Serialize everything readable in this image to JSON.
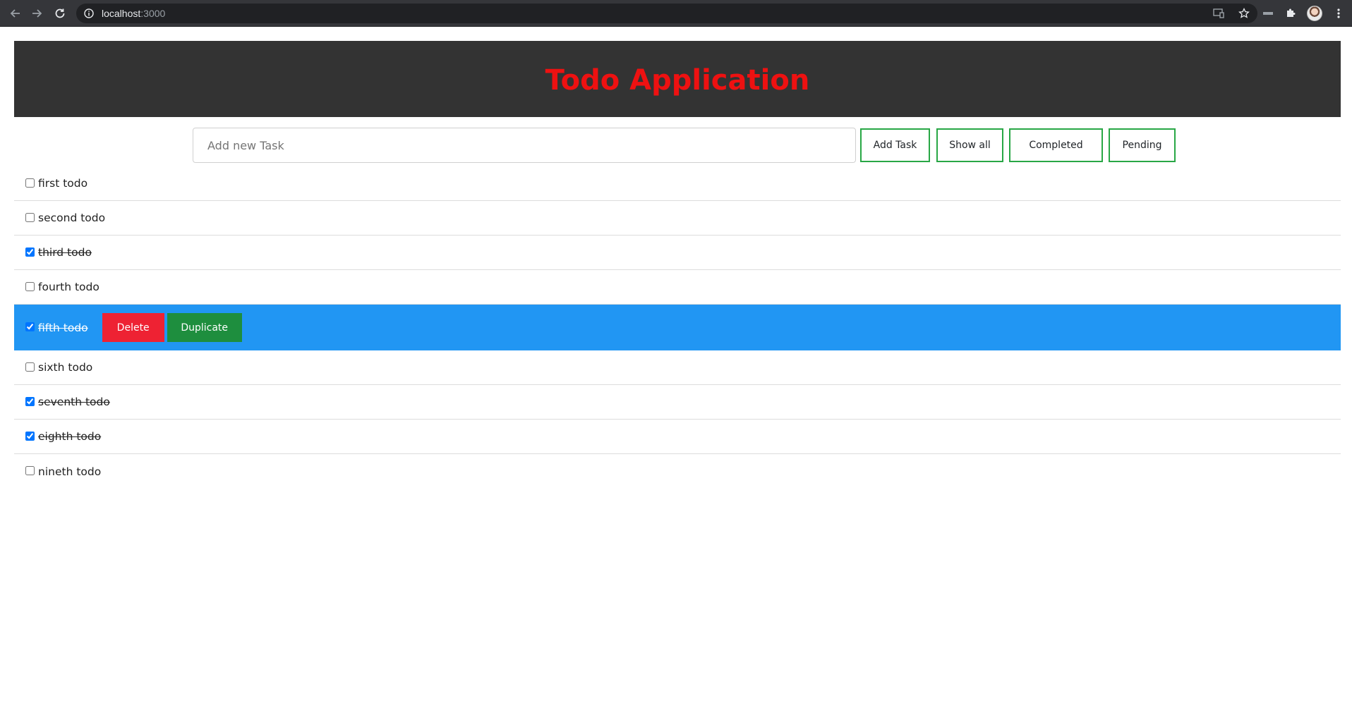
{
  "browser": {
    "url_host": "localhost",
    "url_port": ":3000"
  },
  "app": {
    "title": "Todo Application",
    "title_color": "#ee1111",
    "header_bg": "#333333",
    "accent_border": "#28a745",
    "selected_bg": "#2196f3"
  },
  "toolbar": {
    "input_placeholder": "Add new Task",
    "input_value": "",
    "add_label": "Add Task",
    "show_all_label": "Show all",
    "completed_label": "Completed",
    "pending_label": "Pending"
  },
  "todos": [
    {
      "label": "first todo",
      "completed": false
    },
    {
      "label": "second todo",
      "completed": false
    },
    {
      "label": "third todo",
      "completed": true
    },
    {
      "label": "fourth todo",
      "completed": false
    },
    {
      "label": "fifth todo",
      "completed": true,
      "selected": true
    },
    {
      "label": "sixth todo",
      "completed": false
    },
    {
      "label": "seventh todo",
      "completed": true
    },
    {
      "label": "eighth todo",
      "completed": true
    },
    {
      "label": "nineth todo",
      "completed": false
    }
  ],
  "row_actions": {
    "delete_label": "Delete",
    "duplicate_label": "Duplicate"
  },
  "icons": {
    "back": "back-arrow-icon",
    "forward": "forward-arrow-icon",
    "reload": "reload-icon",
    "info": "info-icon",
    "cast": "cast-icon",
    "bookmark": "star-icon",
    "extensions": "puzzle-icon",
    "menu": "kebab-menu-icon"
  }
}
